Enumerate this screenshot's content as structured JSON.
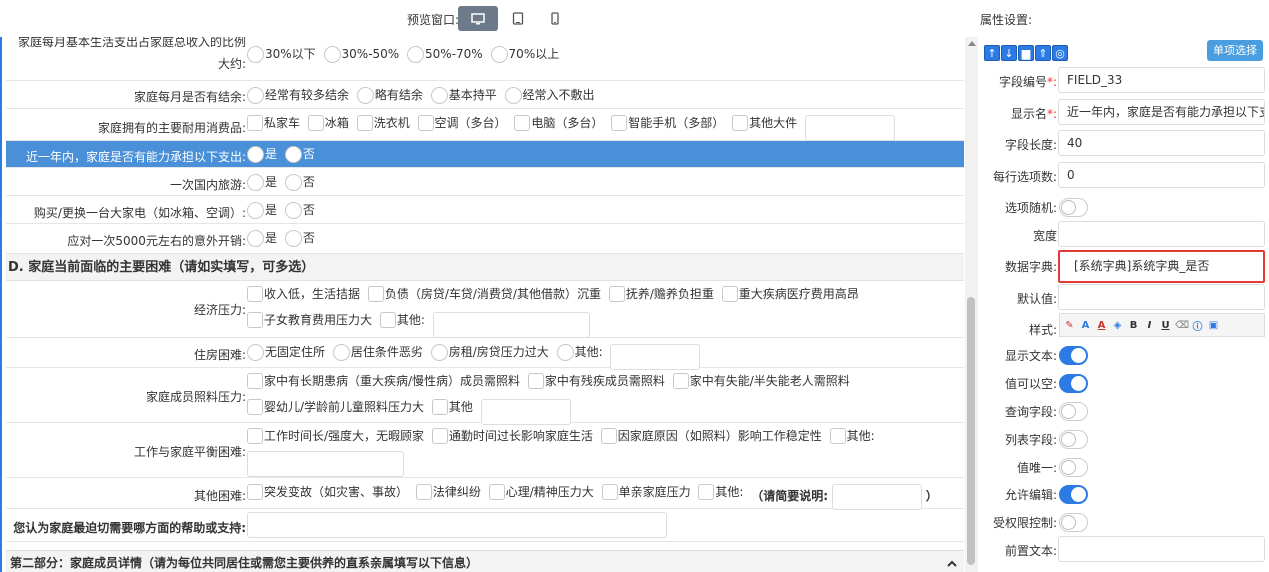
{
  "topbar": {
    "preview_label": "预览窗口:",
    "devices": [
      "desktop-icon",
      "tablet-icon",
      "mobile-icon"
    ],
    "attr_label": "属性设置:"
  },
  "form": {
    "rows": [
      {
        "label_lines": [
          "家庭每月基本生活支出占家庭总收入的比例",
          "大约:"
        ],
        "options": [
          "30%以下",
          "30%-50%",
          "50%-70%",
          "70%以上"
        ]
      },
      {
        "label": "家庭每月是否有结余:",
        "options": [
          "经常有较多结余",
          "略有结余",
          "基本持平",
          "经常入不敷出"
        ]
      },
      {
        "label": "家庭拥有的主要耐用消费品:",
        "options": [
          "私家车",
          "冰箱",
          "洗衣机",
          "空调（多台）",
          "电脑（多台）",
          "智能手机（多部）",
          "其他大件"
        ]
      },
      {
        "label": "近一年内，家庭是否有能力承担以下支出:",
        "options": [
          "是",
          "否"
        ]
      },
      {
        "label": "一次国内旅游:",
        "options": [
          "是",
          "否"
        ]
      },
      {
        "label": "购买/更换一台大家电（如冰箱、空调）:",
        "options": [
          "是",
          "否"
        ]
      },
      {
        "label": "应对一次5000元左右的意外开销:",
        "options": [
          "是",
          "否"
        ]
      }
    ],
    "section_d_title": "D. 家庭当前面临的主要困难（请如实填写，可多选）",
    "d_rows": [
      {
        "label": "经济压力:",
        "options": [
          "收入低，生活拮据",
          "负债（房贷/车贷/消费贷/其他借款）沉重",
          "抚养/赡养负担重",
          "重大疾病医疗费用高昂",
          "子女教育费用压力大",
          "其他:"
        ]
      },
      {
        "label": "住房困难:",
        "options": [
          "无固定住所",
          "居住条件恶劣",
          "房租/房贷压力过大",
          "其他:"
        ]
      },
      {
        "label": "家庭成员照料压力:",
        "options": [
          "家中有长期患病（重大疾病/慢性病）成员需照料",
          "家中有残疾成员需照料",
          "家中有失能/半失能老人需照料",
          "婴幼儿/学龄前儿童照料压力大",
          "其他"
        ]
      },
      {
        "label": "工作与家庭平衡困难:",
        "options": [
          "工作时间长/强度大，无暇顾家",
          "通勤时间过长影响家庭生活",
          "因家庭原因（如照料）影响工作稳定性",
          "其他:"
        ]
      },
      {
        "label": "其他困难:",
        "options": [
          "突发变故（如灾害、事故）",
          "法律纠纷",
          "心理/精神压力大",
          "单亲家庭压力",
          "其他:"
        ],
        "note": "（请简要说明:",
        "note_end": "）"
      },
      {
        "label": "您认为家庭最迫切需要哪方面的帮助或支持:"
      }
    ],
    "part2_title": "第二部分：家庭成员详情（请为每位共同居住或需您主要供养的直系亲属填写以下信息）"
  },
  "panel": {
    "single_select_btn": "单项选择",
    "field_id_label": "字段编号",
    "field_id_value": "FIELD_33",
    "display_name_label": "显示名",
    "display_name_value": "近一年内，家庭是否有能力承担以下支",
    "field_length_label": "字段长度:",
    "field_length_value": "40",
    "per_row_label": "每行选项数:",
    "per_row_value": "0",
    "random_label": "选项随机:",
    "width_label": "宽度",
    "dict_label": "数据字典:",
    "dict_value": "[系统字典]系统字典_是否",
    "default_label": "默认值:",
    "style_label": "样式:",
    "show_text_label": "显示文本:",
    "nullable_label": "值可以空:",
    "query_label": "查询字段:",
    "list_label": "列表字段:",
    "unique_label": "值唯一:",
    "editable_label": "允许编辑:",
    "perm_label": "受权限控制:",
    "prefix_label": "前置文本:"
  },
  "colors": {
    "accent": "#2c7be5",
    "selected_row": "#4a90d9",
    "highlight_border": "#e53935"
  }
}
